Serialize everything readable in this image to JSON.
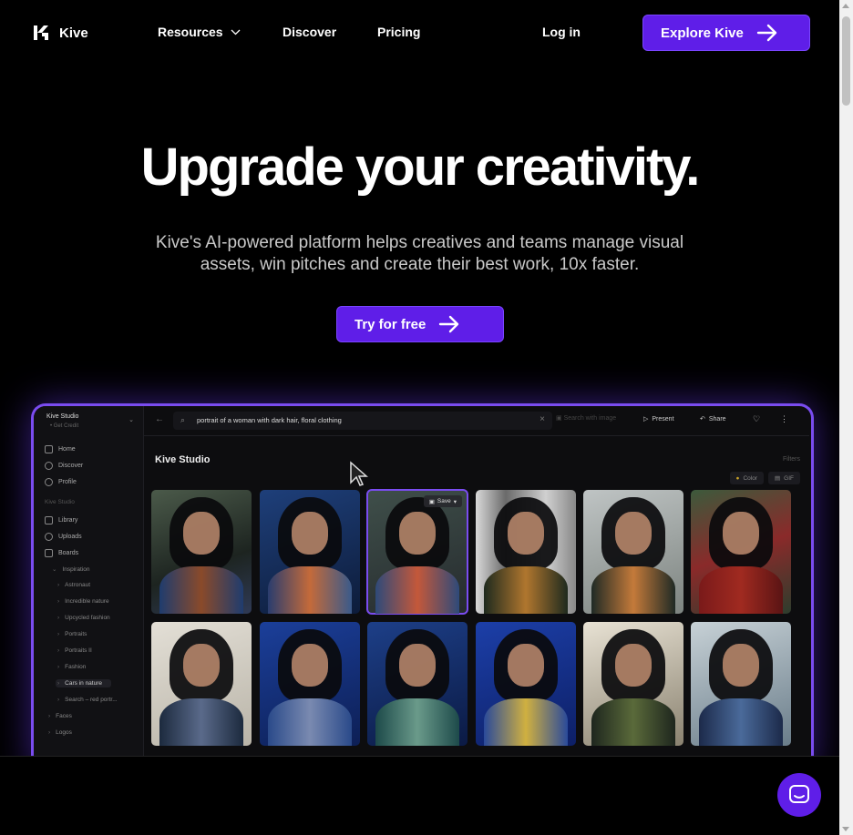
{
  "brand": {
    "name": "Kive"
  },
  "nav": {
    "resources": "Resources",
    "discover": "Discover",
    "pricing": "Pricing",
    "login": "Log in",
    "cta": "Explore Kive"
  },
  "hero": {
    "title": "Upgrade your creativity.",
    "subtitle": "Kive's AI-powered platform helps creatives and teams manage visual assets, win pitches and create their best work, 10x faster.",
    "cta": "Try for free"
  },
  "app": {
    "workspace": "Kive Studio",
    "workspace_sub": "• Get Credit",
    "sidebar": {
      "main": [
        "Home",
        "Discover",
        "Profile"
      ],
      "section": "Kive Studio",
      "library": [
        "Library",
        "Uploads",
        "Boards"
      ],
      "folder": "Inspiration",
      "boards": [
        "Astronaut",
        "Incredible nature",
        "Upcycled fashion",
        "Portraits",
        "Portraits II",
        "Fashion",
        "Cars in nature",
        "Search – red portr..."
      ],
      "bottom": [
        "Faces",
        "Logos"
      ]
    },
    "search": {
      "query": "portrait of a woman with dark hair, floral clothing",
      "image_search": "Search with image"
    },
    "toolbar": {
      "present": "Present",
      "share": "Share"
    },
    "title": "Kive Studio",
    "filters": "Filters",
    "chips": [
      "Color",
      "GIF"
    ],
    "save": "Save"
  },
  "colors": {
    "accent": "#5f1ee8",
    "accent_border": "#7a4cf0"
  }
}
